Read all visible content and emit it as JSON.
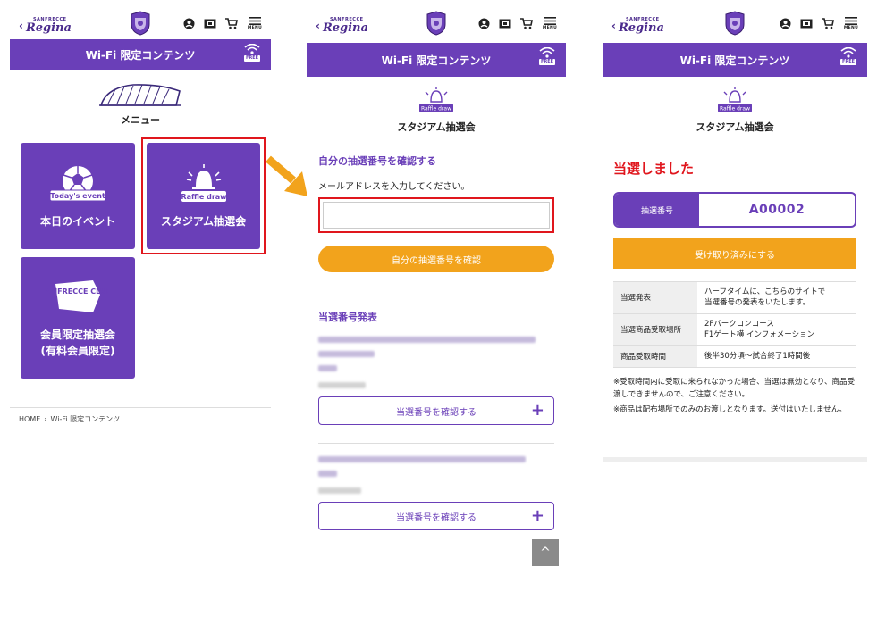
{
  "brand": {
    "top": "SANFRECCE",
    "main": "Regina"
  },
  "nav": {
    "menu_label": "MENU"
  },
  "header": {
    "title": "Wi-Fi 限定コンテンツ",
    "free": "FREE"
  },
  "screen1": {
    "menu_heading": "メニュー",
    "tiles": [
      {
        "icon_text": "Today's event",
        "label": "本日のイベント"
      },
      {
        "icon_text": "Raffle draw",
        "label": "スタジアム抽選会"
      },
      {
        "icon_text": "SANFRECCE CLUB",
        "label_line1": "会員限定抽選会",
        "label_line2": "(有料会員限定)"
      }
    ],
    "breadcrumb": {
      "home": "HOME",
      "sep": "›",
      "current": "Wi-Fi 限定コンテンツ"
    }
  },
  "screen2": {
    "raffle_icon_text": "Raffle draw",
    "section_title": "スタジアム抽選会",
    "check_heading": "自分の抽選番号を確認する",
    "email_label": "メールアドレスを入力してください。",
    "email_placeholder": "",
    "check_button": "自分の抽選番号を確認",
    "announce_heading": "当選番号発表",
    "entries": [
      {
        "button": "当選番号を確認する"
      },
      {
        "button": "当選番号を確認する"
      }
    ],
    "scroll_top": "^"
  },
  "screen3": {
    "raffle_icon_text": "Raffle draw",
    "section_title": "スタジアム抽選会",
    "win_title": "当選しました",
    "number_label": "抽選番号",
    "number_value": "A00002",
    "receive_button": "受け取り済みにする",
    "table": [
      {
        "key": "当選発表",
        "line1": "ハーフタイムに、こちらのサイトで",
        "line2": "当選番号の発表をいたします。"
      },
      {
        "key": "当選商品受取場所",
        "line1": "2Fパークコンコース",
        "line2": "F1ゲート横 インフォメーション"
      },
      {
        "key": "商品受取時間",
        "line1": "後半30分頃〜試合終了1時間後",
        "line2": ""
      }
    ],
    "notes": [
      "※受取時間内に受取に来られなかった場合、当選は無効となり、商品受渡しできませんので、ご注意ください。",
      "※商品は配布場所でのみのお渡しとなります。送付はいたしません。"
    ]
  },
  "colors": {
    "purple": "#6a3fb8",
    "orange": "#f2a31c",
    "red": "#e0161d"
  }
}
